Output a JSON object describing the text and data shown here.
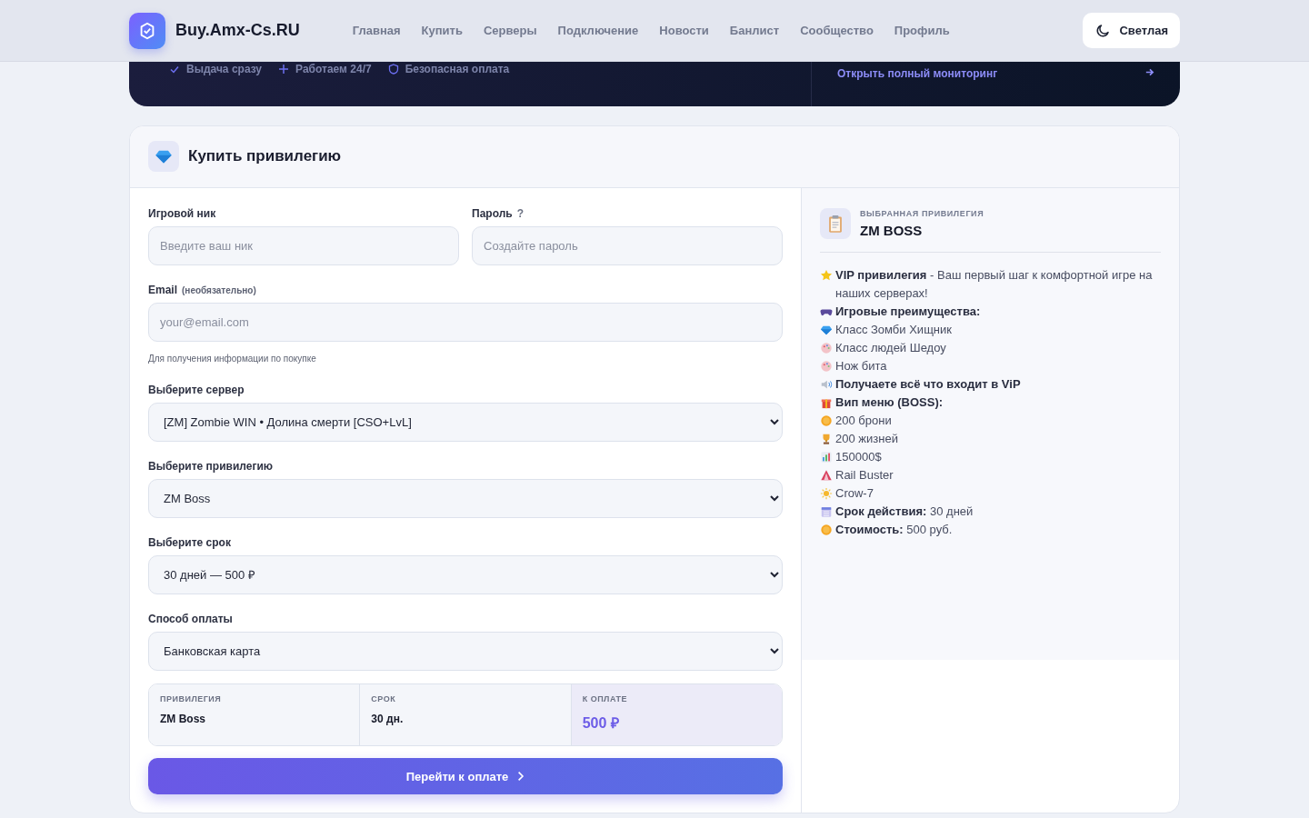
{
  "header": {
    "logo": "Buy.Amx-Cs.RU",
    "nav": [
      "Главная",
      "Купить",
      "Серверы",
      "Подключение",
      "Новости",
      "Банлист",
      "Сообщество",
      "Профиль"
    ],
    "theme_button": "Светлая"
  },
  "banner": {
    "features": [
      "Выдача сразу",
      "Работаем 24/7",
      "Безопасная оплата"
    ],
    "monitoring_link": "Открыть полный мониторинг"
  },
  "form": {
    "title": "Купить привилегию",
    "nick": {
      "label": "Игровой ник",
      "placeholder": "Введите ваш ник"
    },
    "password": {
      "label": "Пароль",
      "help": "?",
      "placeholder": "Создайте пароль"
    },
    "email": {
      "label": "Email",
      "note": "(необязательно)",
      "placeholder": "your@email.com",
      "hint": "Для получения информации по покупке"
    },
    "selects": [
      {
        "label": "Выберите сервер",
        "value": "[ZM] Zombie WIN • Долина смерти [CSO+LvL]"
      },
      {
        "label": "Выберите привилегию",
        "value": "ZM Boss"
      },
      {
        "label": "Выберите срок",
        "value": "30 дней — 500 ₽"
      },
      {
        "label": "Способ оплаты",
        "value": "Банковская карта"
      }
    ],
    "summary": [
      {
        "label": "ПРИВИЛЕГИЯ",
        "value": "ZM Boss",
        "highlight": false
      },
      {
        "label": "СРОК",
        "value": "30 дн.",
        "highlight": false
      },
      {
        "label": "К ОПЛАТЕ",
        "value": "500 ₽",
        "highlight": true
      }
    ],
    "submit": "Перейти к оплате"
  },
  "selected_panel": {
    "caption": "ВЫБРАННАЯ ПРИВИЛЕГИЯ",
    "title": "ZM BOSS",
    "lines": [
      "**VIP привилегия** - Ваш первый шаг к комфортной игре на наших серверах!",
      "**Игровые преимущества:**",
      "Класс Зомби Хищник",
      "Класс людей Шедоу",
      "Нож бита",
      "**Получаете всё что входит в ViP**",
      "**Вип меню (BOSS):**",
      "200 брони",
      "200 жизней",
      "150000$",
      "Rail Buster",
      "Crow-7",
      "**Срок действия:** 30 дней",
      "**Стоимость:** 500 руб."
    ]
  }
}
